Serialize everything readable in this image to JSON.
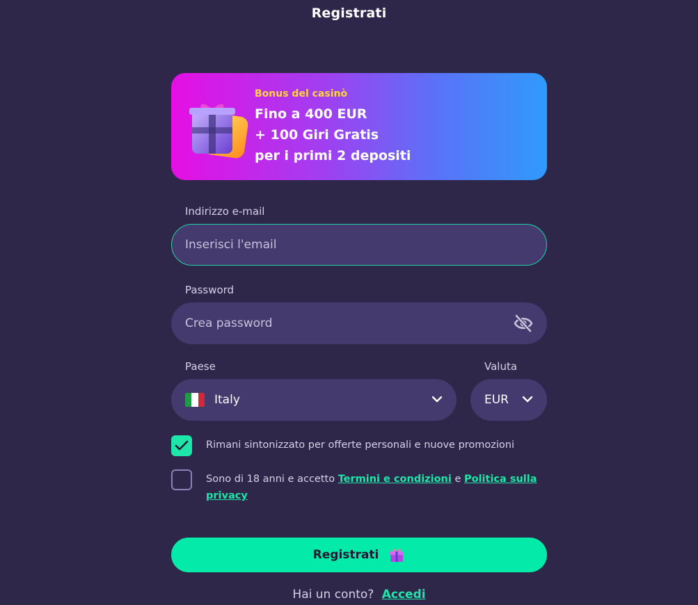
{
  "header": {
    "title": "Registrati"
  },
  "bonus": {
    "label": "Bonus del casinò",
    "line1": "Fino a 400 EUR",
    "line2": "+ 100 Giri Gratis",
    "line3": "per i primi 2 depositi"
  },
  "email": {
    "label": "Indirizzo e-mail",
    "placeholder": "Inserisci l'email"
  },
  "password": {
    "label": "Password",
    "placeholder": "Crea password"
  },
  "country": {
    "label": "Paese",
    "value": "Italy"
  },
  "currency": {
    "label": "Valuta",
    "value": "EUR"
  },
  "consents": {
    "newsletter": {
      "text": "Rimani sintonizzato per offerte personali e nuove promozioni",
      "checked": true
    },
    "terms": {
      "prefix": "Sono di 18 anni e accetto",
      "terms_link": "Termini e condizioni",
      "and": "e",
      "privacy_link": "Politica sulla privacy",
      "checked": false
    }
  },
  "submit": {
    "label": "Registrati"
  },
  "footer": {
    "question": "Hai un conto?",
    "login_link": "Accedi"
  },
  "colors": {
    "accent": "#04eba9",
    "background": "#2e2749",
    "field": "#443a6e",
    "bonus_label": "#ffd632"
  },
  "icons": [
    "gift-box-art",
    "eye-off-icon",
    "italy-flag-icon",
    "chevron-down-icon",
    "checkmark-icon",
    "gift-icon"
  ]
}
